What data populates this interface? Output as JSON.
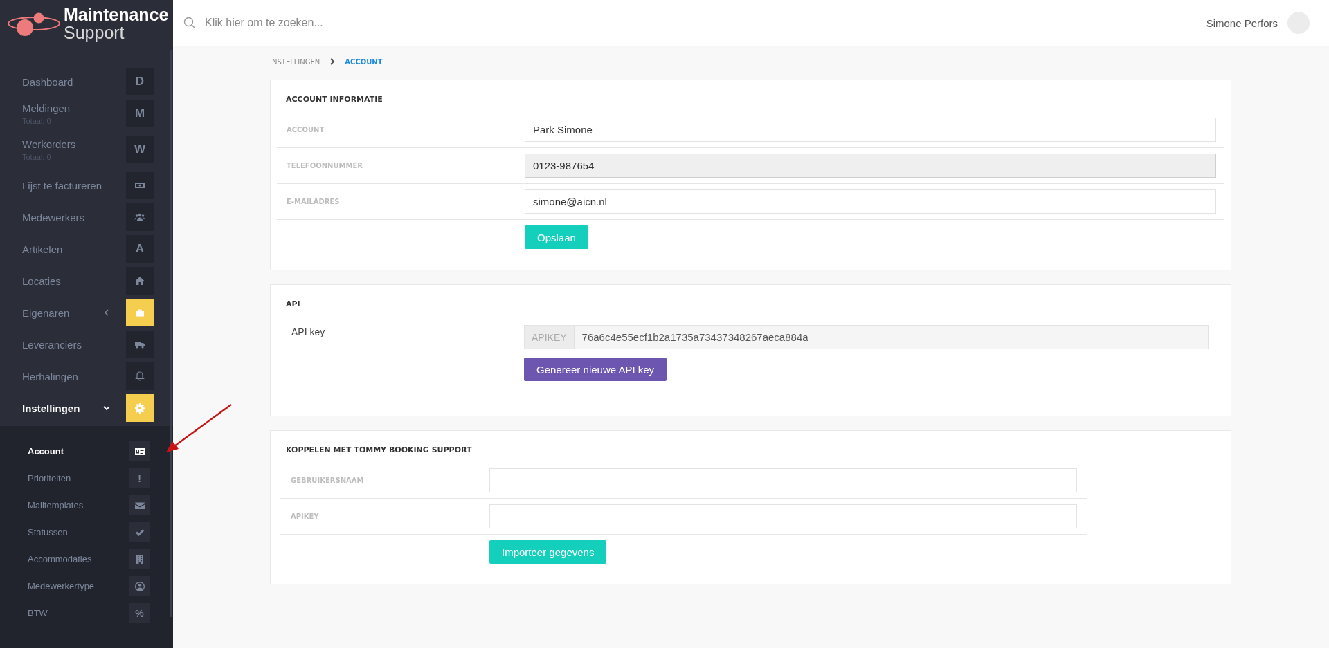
{
  "logo": {
    "title": "Maintenance",
    "subtitle": "Support"
  },
  "search": {
    "placeholder": "Klik hier om te zoeken..."
  },
  "user": {
    "name": "Simone Perfors"
  },
  "sidebar": {
    "items": [
      {
        "label": "Dashboard",
        "kind": "letter",
        "letter": "D",
        "selected": false,
        "highlighted": false
      },
      {
        "label": "Meldingen",
        "subtitle": "Totaal: 0",
        "kind": "letter",
        "letter": "M",
        "selected": false,
        "highlighted": false
      },
      {
        "label": "Werkorders",
        "subtitle": "Totaal: 0",
        "kind": "letter",
        "letter": "W",
        "selected": false,
        "highlighted": false
      },
      {
        "label": "Lijst te factureren",
        "kind": "icon",
        "selected": false,
        "highlighted": false
      },
      {
        "label": "Medewerkers",
        "kind": "icon",
        "selected": false,
        "highlighted": false
      },
      {
        "label": "Artikelen",
        "kind": "letter",
        "letter": "A",
        "selected": false,
        "highlighted": false
      },
      {
        "label": "Locaties",
        "kind": "icon",
        "selected": false,
        "highlighted": false
      },
      {
        "label": "Eigenaren",
        "kind": "icon",
        "selected": false,
        "highlighted": true,
        "expanded": false
      },
      {
        "label": "Leveranciers",
        "kind": "icon",
        "selected": false,
        "highlighted": false
      },
      {
        "label": "Herhalingen",
        "kind": "icon",
        "selected": false,
        "highlighted": false
      },
      {
        "label": "Instellingen",
        "kind": "icon",
        "selected": true,
        "highlighted": true,
        "expanded": true,
        "children": [
          {
            "label": "Account",
            "kind": "icon",
            "selected": true
          },
          {
            "label": "Prioriteiten",
            "kind": "letter",
            "letter": "!",
            "selected": false
          },
          {
            "label": "Mailtemplates",
            "kind": "icon",
            "selected": false
          },
          {
            "label": "Statussen",
            "kind": "icon",
            "selected": false
          },
          {
            "label": "Accommodaties",
            "kind": "icon",
            "selected": false
          },
          {
            "label": "Medewerkertype",
            "kind": "icon",
            "selected": false
          },
          {
            "label": "BTW",
            "kind": "letter",
            "letter": "%",
            "selected": false
          }
        ]
      }
    ]
  },
  "breadcrumb": [
    {
      "label": "INSTELLINGEN",
      "selected": false
    },
    {
      "label": "ACCOUNT",
      "selected": true
    }
  ],
  "account_card": {
    "title": "ACCOUNT INFORMATIE",
    "fields": [
      {
        "label": "ACCOUNT",
        "value": "Park Simone",
        "focused": false
      },
      {
        "label": "TELEFOONNUMMER",
        "value": "0123-987654",
        "focused": true
      },
      {
        "label": "E-MAILADRES",
        "value": "simone@aicn.nl",
        "focused": false
      }
    ],
    "button": "Opslaan"
  },
  "api_card": {
    "title": "API",
    "label": "API key",
    "addon": "APIKEY",
    "value": "76a6c4e55ecf1b2a1735a73437348267aeca884a",
    "button": "Genereer nieuwe API key"
  },
  "booking_card": {
    "title": "KOPPELEN MET TOMMY BOOKING SUPPORT",
    "fields": [
      {
        "label": "GEBRUIKERSNAAM"
      },
      {
        "label": "APIKEY"
      }
    ],
    "button": "Importeer gegevens"
  }
}
